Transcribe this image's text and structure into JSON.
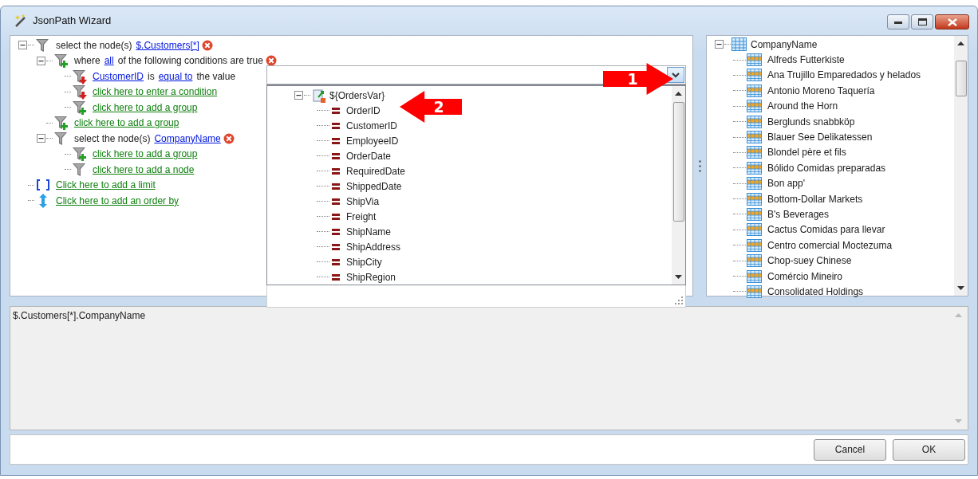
{
  "window": {
    "title": "JsonPath Wizard"
  },
  "query_tree": [
    {
      "kind": "select",
      "expanded": true,
      "removable": true,
      "segments": [
        {
          "kind": "text",
          "text": "select the node(s)"
        },
        {
          "kind": "link",
          "text": "$.Customers[*]"
        }
      ],
      "children": [
        {
          "kind": "where",
          "expanded": true,
          "removable": true,
          "segments": [
            {
              "kind": "text",
              "text": "where"
            },
            {
              "kind": "link",
              "text": "all"
            },
            {
              "kind": "text",
              "text": "of the following conditions are true"
            }
          ],
          "children": [
            {
              "kind": "condition",
              "removable": false,
              "segments": [
                {
                  "kind": "link",
                  "text": "CustomerID"
                },
                {
                  "kind": "text",
                  "text": "is"
                },
                {
                  "kind": "link",
                  "text": "equal to"
                },
                {
                  "kind": "text",
                  "text": "the value"
                }
              ]
            },
            {
              "kind": "add_condition",
              "removable": false,
              "segments": [
                {
                  "kind": "action",
                  "text": "click here to enter a condition"
                }
              ]
            },
            {
              "kind": "add_group",
              "removable": false,
              "segments": [
                {
                  "kind": "action",
                  "text": "click here to add a group"
                }
              ]
            }
          ]
        },
        {
          "kind": "add_group",
          "removable": false,
          "segments": [
            {
              "kind": "action",
              "text": "click here to add a group"
            }
          ]
        },
        {
          "kind": "select",
          "expanded": true,
          "removable": true,
          "segments": [
            {
              "kind": "text",
              "text": "select the node(s)"
            },
            {
              "kind": "link",
              "text": "CompanyName"
            }
          ],
          "children": [
            {
              "kind": "add_group",
              "removable": false,
              "segments": [
                {
                  "kind": "action",
                  "text": "click here to add a group"
                }
              ]
            },
            {
              "kind": "add_node",
              "removable": false,
              "segments": [
                {
                  "kind": "action",
                  "text": "click here to add a node"
                }
              ]
            }
          ]
        }
      ]
    },
    {
      "kind": "limit",
      "removable": false,
      "segments": [
        {
          "kind": "action",
          "text": "Click here to add a limit"
        }
      ]
    },
    {
      "kind": "order",
      "removable": false,
      "segments": [
        {
          "kind": "action",
          "text": "Click here to add an order by"
        }
      ]
    }
  ],
  "value_dropdown": {
    "root": {
      "label": "${OrdersVar}",
      "expanded": true,
      "children": [
        "OrderID",
        "CustomerID",
        "EmployeeID",
        "OrderDate",
        "RequiredDate",
        "ShippedDate",
        "ShipVia",
        "Freight",
        "ShipName",
        "ShipAddress",
        "ShipCity",
        "ShipRegion"
      ]
    }
  },
  "callouts": [
    {
      "label": "1"
    },
    {
      "label": "2"
    }
  ],
  "node_tree": {
    "label": "CompanyName",
    "expanded": true,
    "children": [
      "Alfreds Futterkiste",
      "Ana Trujillo Emparedados y helados",
      "Antonio Moreno Taquería",
      "Around the Horn",
      "Berglunds snabbköp",
      "Blauer See Delikatessen",
      "Blondel père et fils",
      "Bólido Comidas preparadas",
      "Bon app'",
      "Bottom-Dollar Markets",
      "B's Beverages",
      "Cactus Comidas para llevar",
      "Centro comercial Moctezuma",
      "Chop-suey Chinese",
      "Comércio Mineiro",
      "Consolidated Holdings"
    ]
  },
  "expression": "$.Customers[*].CompanyName",
  "buttons": [
    {
      "label": "Cancel"
    },
    {
      "label": "OK"
    }
  ]
}
